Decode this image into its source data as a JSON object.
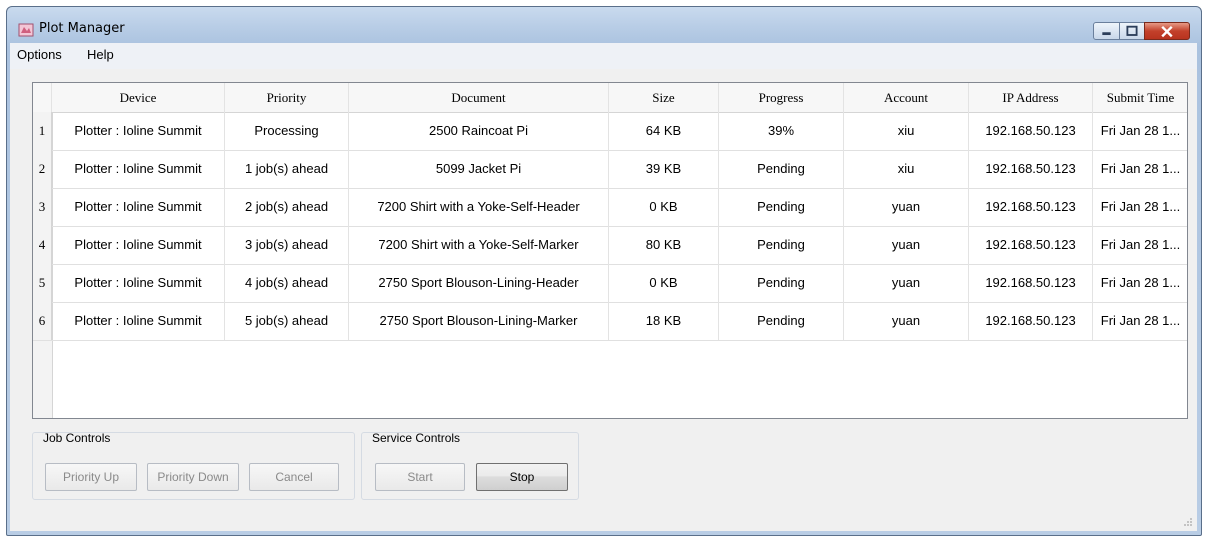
{
  "window": {
    "title": "Plot Manager"
  },
  "menu": [
    "Options",
    "Help"
  ],
  "table": {
    "columns": [
      "Device",
      "Priority",
      "Document",
      "Size",
      "Progress",
      "Account",
      "IP Address",
      "Submit Time"
    ],
    "rows": [
      {
        "num": "1",
        "cells": [
          "Plotter : Ioline Summit",
          "Processing",
          "2500 Raincoat Pi",
          "64 KB",
          "39%",
          "xiu",
          "192.168.50.123",
          "Fri Jan 28 1..."
        ]
      },
      {
        "num": "2",
        "cells": [
          "Plotter : Ioline Summit",
          "1 job(s) ahead",
          "5099 Jacket Pi",
          "39 KB",
          "Pending",
          "xiu",
          "192.168.50.123",
          "Fri Jan 28 1..."
        ]
      },
      {
        "num": "3",
        "cells": [
          "Plotter : Ioline Summit",
          "2 job(s) ahead",
          "7200 Shirt with a Yoke-Self-Header",
          "0 KB",
          "Pending",
          "yuan",
          "192.168.50.123",
          "Fri Jan 28 1..."
        ]
      },
      {
        "num": "4",
        "cells": [
          "Plotter : Ioline Summit",
          "3 job(s) ahead",
          "7200 Shirt with a Yoke-Self-Marker",
          "80 KB",
          "Pending",
          "yuan",
          "192.168.50.123",
          "Fri Jan 28 1..."
        ]
      },
      {
        "num": "5",
        "cells": [
          "Plotter : Ioline Summit",
          "4 job(s) ahead",
          "2750 Sport Blouson-Lining-Header",
          "0 KB",
          "Pending",
          "yuan",
          "192.168.50.123",
          "Fri Jan 28 1..."
        ]
      },
      {
        "num": "6",
        "cells": [
          "Plotter : Ioline Summit",
          "5 job(s) ahead",
          "2750 Sport Blouson-Lining-Marker",
          "18 KB",
          "Pending",
          "yuan",
          "192.168.50.123",
          "Fri Jan 28 1..."
        ]
      }
    ]
  },
  "job_controls": {
    "label": "Job Controls",
    "priority_up": "Priority Up",
    "priority_down": "Priority Down",
    "cancel": "Cancel"
  },
  "service_controls": {
    "label": "Service Controls",
    "start": "Start",
    "stop": "Stop"
  }
}
